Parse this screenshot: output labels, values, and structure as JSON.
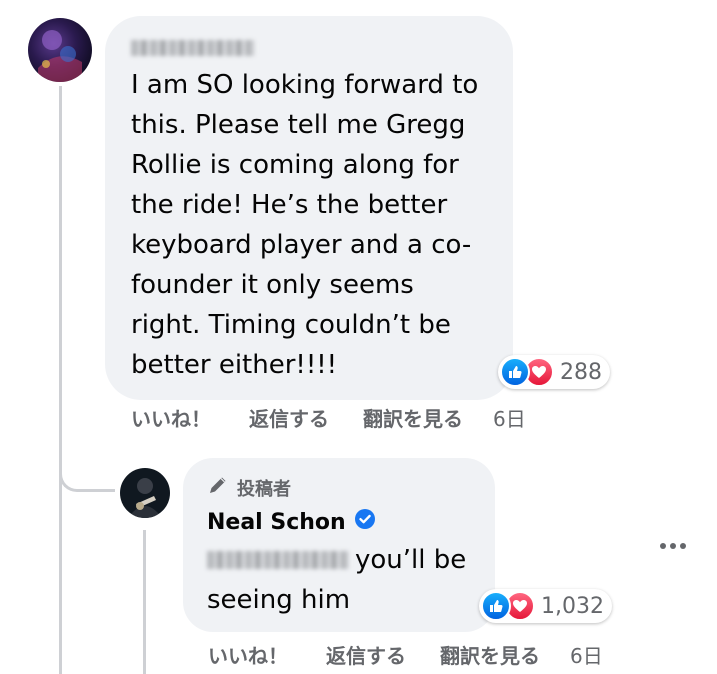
{
  "comment": {
    "text": "I am SO looking forward to\nthis. Please tell me Gregg\nRollie is coming along for\nthe ride! He’s the better\nkeyboard player and a co-\nfounder it only seems\nright. Timing couldn’t be\nbetter either!!!!",
    "reaction_count": "288",
    "actions": {
      "like": "いいね！",
      "reply": "返信する",
      "translate": "翻訳を見る",
      "time": "6日"
    }
  },
  "reply": {
    "author_badge": "投稿者",
    "author_name": "Neal Schon",
    "text_line1": "you’ll be",
    "text_line2": "seeing him",
    "reaction_count": "1,032",
    "actions": {
      "like": "いいね！",
      "reply": "返信する",
      "translate": "翻訳を見る",
      "time": "6日"
    }
  },
  "icons": {
    "like": "thumbs-up-icon",
    "love": "heart-icon",
    "author": "pen-icon",
    "verified": "verified-badge-icon",
    "more": "more-options-icon"
  },
  "colors": {
    "bubble": "#f0f2f5",
    "secondary_text": "#65676b",
    "like_blue": "#1877f2",
    "love_red": "#f33e58",
    "verified_blue": "#1877f2"
  }
}
